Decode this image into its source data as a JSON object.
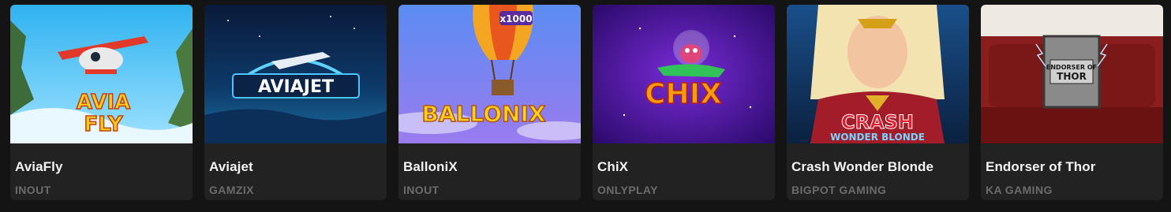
{
  "games": [
    {
      "title": "AviaFly",
      "provider": "INOUT",
      "logo_lines": [
        "AVIA",
        "FLY"
      ]
    },
    {
      "title": "Aviajet",
      "provider": "GAMZIX",
      "logo_lines": [
        "AVIAJET"
      ]
    },
    {
      "title": "BalloniX",
      "provider": "INOUT",
      "logo_lines": [
        "BALLONIX"
      ],
      "badge": "x1000"
    },
    {
      "title": "ChiX",
      "provider": "ONLYPLAY",
      "logo_lines": [
        "CHIX"
      ]
    },
    {
      "title": "Crash Wonder Blonde",
      "provider": "BIGPOT GAMING",
      "logo_lines": [
        "CRASH",
        "WONDER BLONDE"
      ]
    },
    {
      "title": "Endorser of Thor",
      "provider": "KA GAMING",
      "logo_lines": [
        "ENDORSER OF",
        "THOR"
      ]
    }
  ],
  "colors": {
    "page_bg": "#141414",
    "card_bg": "#222222",
    "title_text": "#f2f2f2",
    "provider_text": "#6b6b6b"
  }
}
